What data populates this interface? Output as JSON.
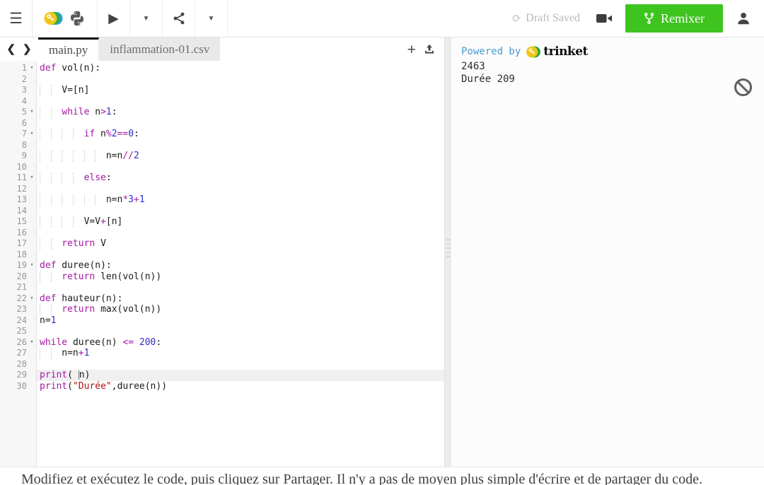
{
  "toolbar": {
    "menu_icon": "☰",
    "run_icon": "▶",
    "caret_icon": "▼",
    "refresh_icon": "⟳",
    "draft_status": "Draft Saved",
    "remix_label": "Remixer"
  },
  "tabs": {
    "prev_icon": "❮",
    "next_icon": "❯",
    "add_icon": "+",
    "items": [
      {
        "label": "main.py",
        "active": true
      },
      {
        "label": "inflammation-01.csv",
        "active": false
      }
    ]
  },
  "editor": {
    "fold_icon": "▾",
    "lines": [
      {
        "n": 1,
        "fold": true,
        "indent": 0,
        "tokens": [
          [
            "k",
            "def"
          ],
          [
            "p",
            " vol(n):"
          ]
        ]
      },
      {
        "n": 2,
        "indent": 0,
        "tokens": []
      },
      {
        "n": 3,
        "indent": 4,
        "tokens": [
          [
            "p",
            "V=[n]"
          ]
        ]
      },
      {
        "n": 4,
        "indent": 0,
        "tokens": []
      },
      {
        "n": 5,
        "fold": true,
        "indent": 4,
        "tokens": [
          [
            "k",
            "while"
          ],
          [
            "p",
            " n"
          ],
          [
            "o",
            ">"
          ],
          [
            "n",
            "1"
          ],
          [
            "p",
            ":"
          ]
        ]
      },
      {
        "n": 6,
        "indent": 0,
        "tokens": []
      },
      {
        "n": 7,
        "fold": true,
        "indent": 8,
        "tokens": [
          [
            "k",
            "if"
          ],
          [
            "p",
            " n"
          ],
          [
            "o",
            "%"
          ],
          [
            "n",
            "2"
          ],
          [
            "o",
            "=="
          ],
          [
            "n",
            "0"
          ],
          [
            "p",
            ":"
          ]
        ]
      },
      {
        "n": 8,
        "indent": 0,
        "tokens": []
      },
      {
        "n": 9,
        "indent": 12,
        "tokens": [
          [
            "p",
            "n=n"
          ],
          [
            "o",
            "//"
          ],
          [
            "n",
            "2"
          ]
        ]
      },
      {
        "n": 10,
        "indent": 0,
        "tokens": []
      },
      {
        "n": 11,
        "fold": true,
        "indent": 8,
        "tokens": [
          [
            "k",
            "else"
          ],
          [
            "p",
            ":"
          ]
        ]
      },
      {
        "n": 12,
        "indent": 0,
        "tokens": []
      },
      {
        "n": 13,
        "indent": 12,
        "tokens": [
          [
            "p",
            "n=n"
          ],
          [
            "o",
            "*"
          ],
          [
            "n",
            "3"
          ],
          [
            "o",
            "+"
          ],
          [
            "n",
            "1"
          ]
        ]
      },
      {
        "n": 14,
        "indent": 0,
        "tokens": []
      },
      {
        "n": 15,
        "indent": 8,
        "tokens": [
          [
            "p",
            "V=V"
          ],
          [
            "o",
            "+"
          ],
          [
            "p",
            "[n]"
          ]
        ]
      },
      {
        "n": 16,
        "indent": 0,
        "tokens": []
      },
      {
        "n": 17,
        "indent": 4,
        "tokens": [
          [
            "k",
            "return"
          ],
          [
            "p",
            " V"
          ]
        ]
      },
      {
        "n": 18,
        "indent": 0,
        "tokens": []
      },
      {
        "n": 19,
        "fold": true,
        "indent": 0,
        "tokens": [
          [
            "k",
            "def"
          ],
          [
            "p",
            " duree(n):"
          ]
        ]
      },
      {
        "n": 20,
        "indent": 4,
        "tokens": [
          [
            "k",
            "return"
          ],
          [
            "p",
            " len(vol(n))"
          ]
        ]
      },
      {
        "n": 21,
        "indent": 0,
        "tokens": []
      },
      {
        "n": 22,
        "fold": true,
        "indent": 0,
        "tokens": [
          [
            "k",
            "def"
          ],
          [
            "p",
            " hauteur(n):"
          ]
        ]
      },
      {
        "n": 23,
        "indent": 4,
        "tokens": [
          [
            "k",
            "return"
          ],
          [
            "p",
            " max(vol(n))"
          ]
        ]
      },
      {
        "n": 24,
        "indent": 0,
        "tokens": [
          [
            "p",
            "n="
          ],
          [
            "n",
            "1"
          ]
        ]
      },
      {
        "n": 25,
        "indent": 0,
        "tokens": []
      },
      {
        "n": 26,
        "fold": true,
        "indent": 0,
        "tokens": [
          [
            "k",
            "while"
          ],
          [
            "p",
            " duree(n) "
          ],
          [
            "o",
            "<="
          ],
          [
            "p",
            " "
          ],
          [
            "n",
            "200"
          ],
          [
            "p",
            ":"
          ]
        ]
      },
      {
        "n": 27,
        "indent": 4,
        "tokens": [
          [
            "p",
            "n=n"
          ],
          [
            "o",
            "+"
          ],
          [
            "n",
            "1"
          ]
        ]
      },
      {
        "n": 28,
        "indent": 0,
        "tokens": []
      },
      {
        "n": 29,
        "indent": 0,
        "active": true,
        "tokens": [
          [
            "k",
            "print"
          ],
          [
            "p",
            "( "
          ],
          [
            "c",
            ""
          ],
          [
            "p",
            "n)"
          ]
        ]
      },
      {
        "n": 30,
        "indent": 0,
        "tokens": [
          [
            "k",
            "print"
          ],
          [
            "p",
            "("
          ],
          [
            "s",
            "\"Durée\""
          ],
          [
            "p",
            ",duree(n))"
          ]
        ]
      }
    ]
  },
  "output": {
    "powered_by": "Powered by",
    "brand": "trinket",
    "lines": [
      "2463",
      "Durée 209"
    ]
  },
  "footer": {
    "text": "Modifiez et exécutez le code, puis cliquez sur Partager. Il n'y a pas de moyen plus simple d'écrire et de partager du code."
  },
  "colors": {
    "remix_green": "#3ec41e",
    "keyword_purple": "#a518a5",
    "number_blue": "#2d2dcc",
    "string_red": "#aa1111",
    "powered_by_blue": "#4a9bd1",
    "active_line_bg": "#f0f0f0"
  }
}
